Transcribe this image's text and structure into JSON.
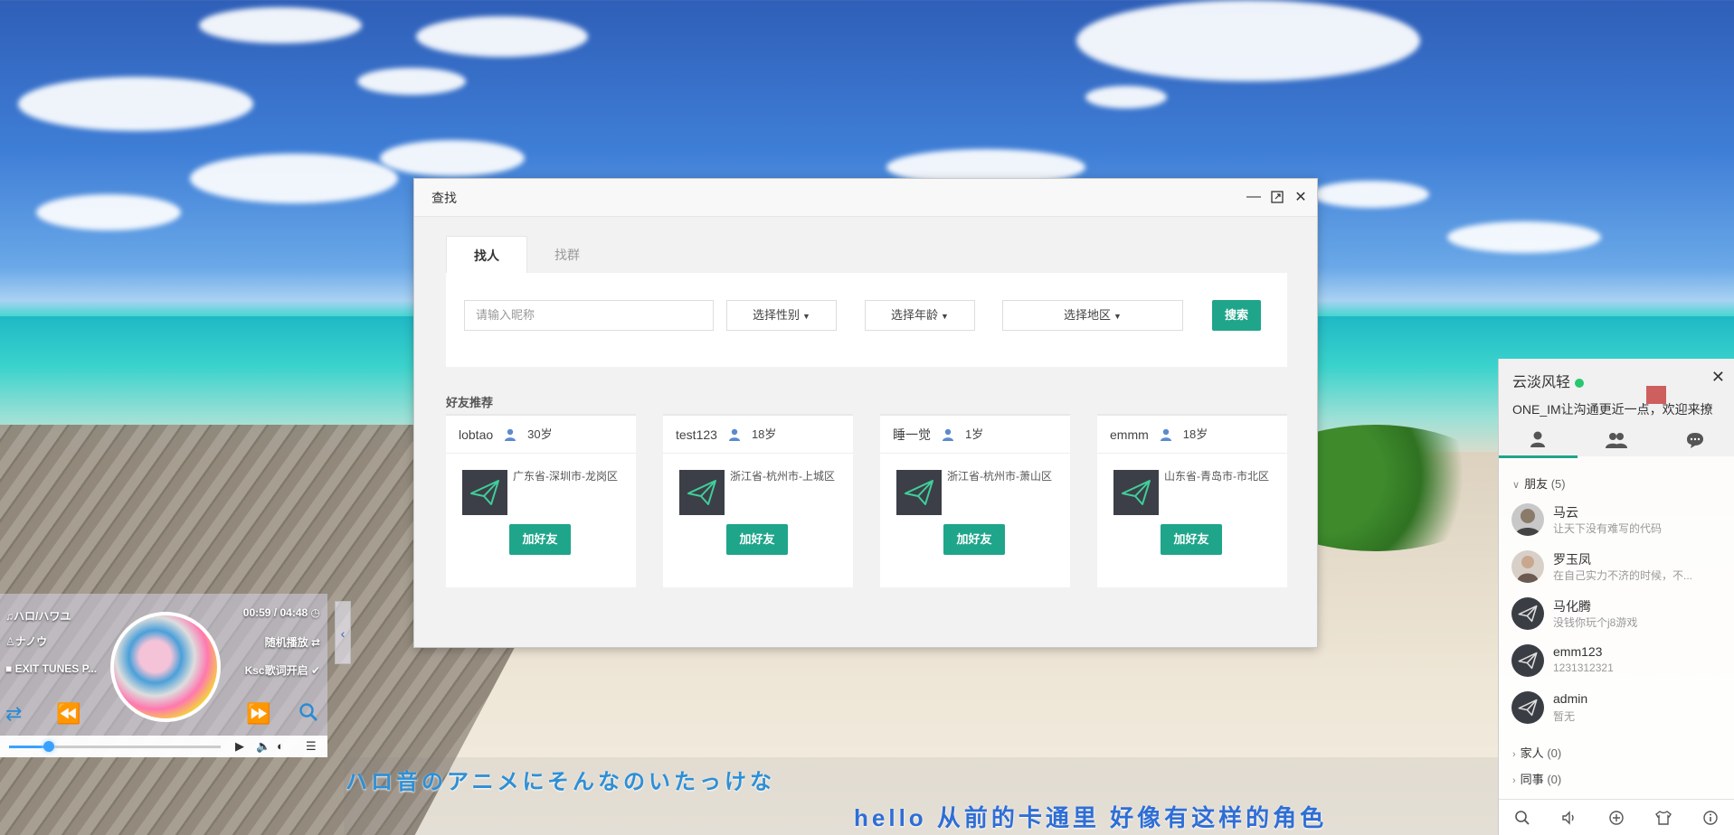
{
  "dialog": {
    "title": "查找",
    "tabs": [
      {
        "label": "找人"
      },
      {
        "label": "找群"
      }
    ],
    "search": {
      "placeholder": "请输入昵称",
      "gender_label": "选择性别",
      "age_label": "选择年龄",
      "region_label": "选择地区",
      "button_label": "搜索"
    },
    "recommend_title": "好友推荐",
    "cards": [
      {
        "name": "lobtao",
        "age": "30岁",
        "address": "广东省-深圳市-龙岗区",
        "button": "加好友"
      },
      {
        "name": "test123",
        "age": "18岁",
        "address": "浙江省-杭州市-上城区",
        "button": "加好友"
      },
      {
        "name": "睡一觉",
        "age": "1岁",
        "address": "浙江省-杭州市-萧山区",
        "button": "加好友"
      },
      {
        "name": "emmm",
        "age": "18岁",
        "address": "山东省-青岛市-市北区",
        "button": "加好友"
      }
    ]
  },
  "im": {
    "username": "云淡风轻",
    "signature": "ONE_IM让沟通更近一点，欢迎来撩",
    "groups": [
      {
        "label": "朋友",
        "count": "(5)"
      },
      {
        "label": "家人",
        "count": "(0)"
      },
      {
        "label": "同事",
        "count": "(0)"
      }
    ],
    "friends": [
      {
        "name": "马云",
        "sign": "让天下没有难写的代码"
      },
      {
        "name": "罗玉凤",
        "sign": "在自己实力不济的时候，不..."
      },
      {
        "name": "马化腾",
        "sign": "没钱你玩个j8游戏"
      },
      {
        "name": "emm123",
        "sign": "1231312321"
      },
      {
        "name": "admin",
        "sign": "暂无"
      }
    ],
    "accent_color": "#1fa58a"
  },
  "player": {
    "song": "ハロ/ハワユ",
    "artist": "ナノウ",
    "album": "EXIT TUNES P...",
    "time": "00:59 / 04:48",
    "mode": "随机播放",
    "lyric_mode": "Ksc歌词开启",
    "progress": 0.19
  },
  "lyrics": {
    "line1": "ハロ音のアニメにそんなのいたっけな",
    "line2": "hello  从前的卡通里  好像有这样的角色"
  }
}
